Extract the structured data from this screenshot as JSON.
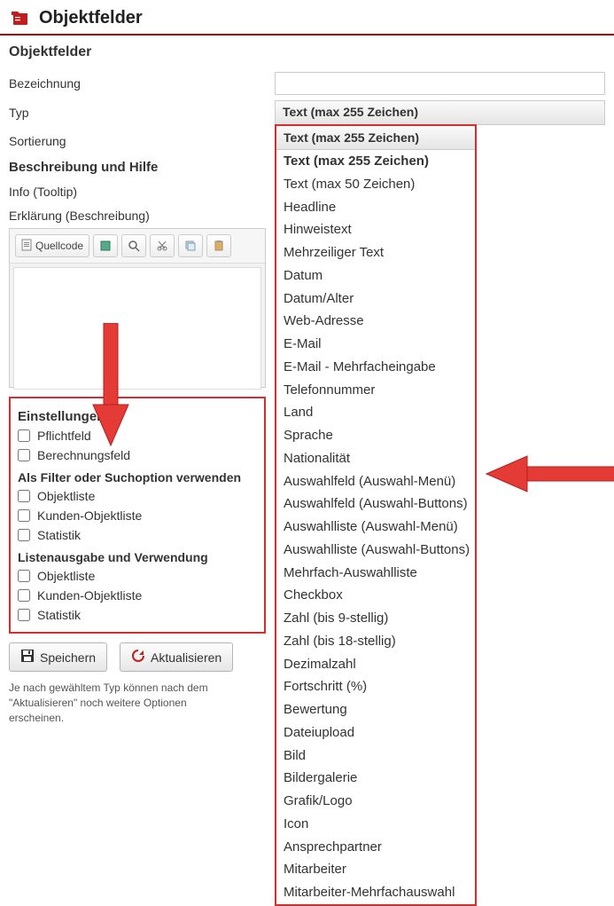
{
  "page": {
    "title": "Objektfelder",
    "subheader": "Objektfelder"
  },
  "form": {
    "bezeichnung_label": "Bezeichnung",
    "bezeichnung_value": "",
    "typ_label": "Typ",
    "typ_selected": "Text (max 255 Zeichen)",
    "sortierung_label": "Sortierung"
  },
  "desc": {
    "section_title": "Beschreibung und Hilfe",
    "info_label": "Info (Tooltip)",
    "erklaerung_label": "Erklärung (Beschreibung)"
  },
  "editor": {
    "source_btn": "Quellcode"
  },
  "settings": {
    "title": "Einstellungen",
    "pflichtfeld": "Pflichtfeld",
    "berechnungsfeld": "Berechnungsfeld",
    "filter_section": "Als Filter oder Suchoption verwenden",
    "objektliste": "Objektliste",
    "kunden_objektliste": "Kunden-Objektliste",
    "statistik": "Statistik",
    "listen_section": "Listenausgabe und Verwendung",
    "objektliste2": "Objektliste",
    "kunden_objektliste2": "Kunden-Objektliste",
    "statistik2": "Statistik"
  },
  "buttons": {
    "save": "Speichern",
    "refresh": "Aktualisieren"
  },
  "hint": "Je nach gewähltem Typ können nach dem \"Aktualisieren\" noch weitere Optionen erscheinen.",
  "dropdown": {
    "header": "Text (max 255 Zeichen)",
    "options": [
      "Text (max 255 Zeichen)",
      "Text (max 50 Zeichen)",
      "Headline",
      "Hinweistext",
      "Mehrzeiliger Text",
      "Datum",
      "Datum/Alter",
      "Web-Adresse",
      "E-Mail",
      "E-Mail - Mehrfacheingabe",
      "Telefonnummer",
      "Land",
      "Sprache",
      "Nationalität",
      "Auswahlfeld (Auswahl-Menü)",
      "Auswahlfeld (Auswahl-Buttons)",
      "Auswahlliste (Auswahl-Menü)",
      "Auswahlliste (Auswahl-Buttons)",
      "Mehrfach-Auswahlliste",
      "Checkbox",
      "Zahl (bis 9-stellig)",
      "Zahl (bis 18-stellig)",
      "Dezimalzahl",
      "Fortschritt (%)",
      "Bewertung",
      "Dateiupload",
      "Bild",
      "Bildergalerie",
      "Grafik/Logo",
      "Icon",
      "Ansprechpartner",
      "Mitarbeiter",
      "Mitarbeiter-Mehrfachauswahl"
    ]
  }
}
